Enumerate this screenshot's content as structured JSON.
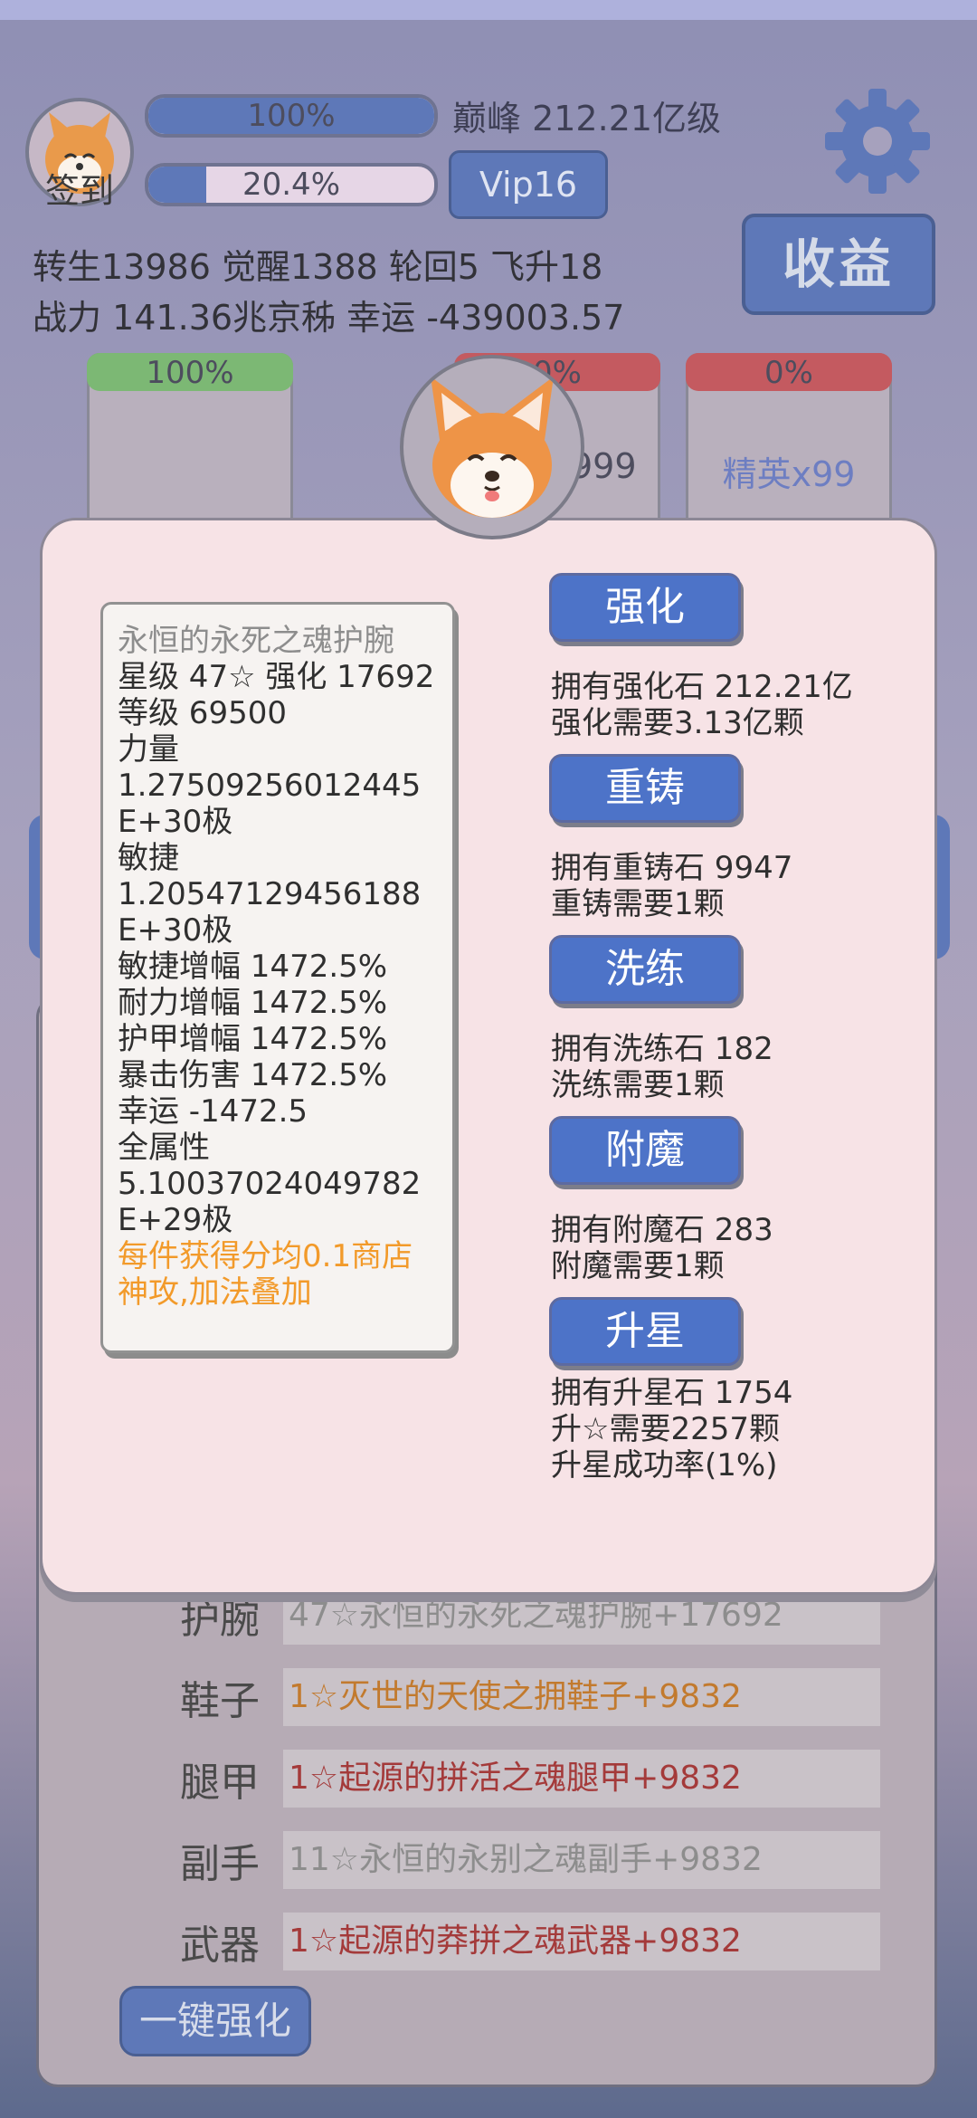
{
  "header": {
    "signin_label": "签到",
    "progress1": {
      "text": "100%",
      "value": 1.0
    },
    "progress2": {
      "text": "20.4%",
      "value": 0.204
    },
    "level_text": "巅峰 212.21亿级",
    "vip_label": "Vip16",
    "income_label": "收益"
  },
  "stats": {
    "line1": "转生13986 觉醒1388 轮回5 飞升18",
    "line2": "战力 141.36兆京秭  幸运 -439003.57"
  },
  "tiles": [
    {
      "top": "100%",
      "label": "",
      "color": "#7cb874"
    },
    {
      "top": "0%",
      "label": "x999",
      "color": "#c45a60"
    },
    {
      "top": "0%",
      "label": "精英x99",
      "color": "#c45a60"
    }
  ],
  "item_card": {
    "name": "永恒的永死之魂护腕",
    "lines": [
      "星级 47☆ 强化 17692",
      "等级 69500",
      "力量",
      "1.27509256012445E+30极",
      "敏捷",
      "1.20547129456188E+30极",
      "敏捷增幅 1472.5%",
      "耐力增幅 1472.5%",
      "护甲增幅 1472.5%",
      "暴击伤害 1472.5%",
      "幸运 -1472.5",
      "全属性",
      "5.10037024049782E+29极"
    ],
    "note": "每件获得分均0.1商店神攻,加法叠加"
  },
  "actions": [
    {
      "label": "强化",
      "info1": "拥有强化石 212.21亿",
      "info2": "强化需要3.13亿颗"
    },
    {
      "label": "重铸",
      "info1": "拥有重铸石 9947",
      "info2": "重铸需要1颗"
    },
    {
      "label": "洗练",
      "info1": "拥有洗练石 182",
      "info2": "洗练需要1颗"
    },
    {
      "label": "附魔",
      "info1": "拥有附魔石 283",
      "info2": "附魔需要1颗"
    },
    {
      "label": "升星",
      "info1": "拥有升星石 1754",
      "info2": "升☆需要2257颗",
      "info3": "升星成功率(1%)"
    }
  ],
  "equipment": [
    {
      "slot": "护腕",
      "value": "47☆永恒的永死之魂护腕+17692",
      "color": "#8d8d8d"
    },
    {
      "slot": "鞋子",
      "value": "1☆灭世的天使之拥鞋子+9832",
      "color": "#c27a2e"
    },
    {
      "slot": "腿甲",
      "value": "1☆起源的拼活之魂腿甲+9832",
      "color": "#a43a3a"
    },
    {
      "slot": "副手",
      "value": "11☆永恒的永别之魂副手+9832",
      "color": "#8d8d8d"
    },
    {
      "slot": "武器",
      "value": "1☆起源的莽拼之魂武器+9832",
      "color": "#a43a3a"
    }
  ],
  "onekey_label": "一键强化"
}
